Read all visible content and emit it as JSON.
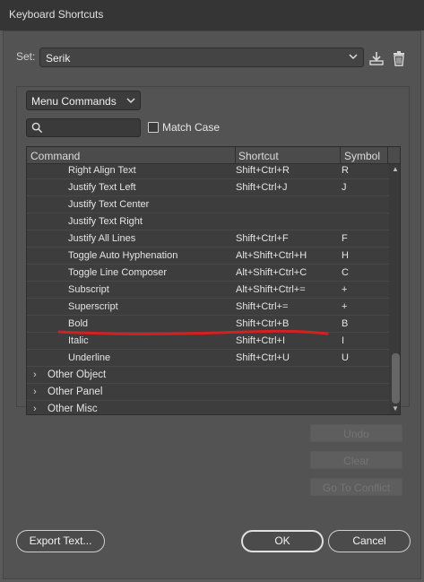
{
  "window": {
    "title": "Keyboard Shortcuts"
  },
  "set": {
    "label": "Set:",
    "value": "Serik"
  },
  "mode": {
    "value": "Menu Commands"
  },
  "search": {
    "placeholder": "",
    "value": ""
  },
  "match_case": {
    "label": "Match Case",
    "checked": false
  },
  "table": {
    "headers": {
      "command": "Command",
      "shortcut": "Shortcut",
      "symbol": "Symbol"
    },
    "rows": [
      {
        "command": "Right Align Text",
        "shortcut": "Shift+Ctrl+R",
        "symbol": "R"
      },
      {
        "command": "Justify Text Left",
        "shortcut": "Shift+Ctrl+J",
        "symbol": "J"
      },
      {
        "command": "Justify Text Center",
        "shortcut": "",
        "symbol": ""
      },
      {
        "command": "Justify Text Right",
        "shortcut": "",
        "symbol": ""
      },
      {
        "command": "Justify All Lines",
        "shortcut": "Shift+Ctrl+F",
        "symbol": "F"
      },
      {
        "command": "Toggle Auto Hyphenation",
        "shortcut": "Alt+Shift+Ctrl+H",
        "symbol": "H"
      },
      {
        "command": "Toggle Line Composer",
        "shortcut": "Alt+Shift+Ctrl+C",
        "symbol": "C"
      },
      {
        "command": "Subscript",
        "shortcut": "Alt+Shift+Ctrl+=",
        "symbol": "+"
      },
      {
        "command": "Superscript",
        "shortcut": "Shift+Ctrl+=",
        "symbol": "+"
      },
      {
        "command": "Bold",
        "shortcut": "Shift+Ctrl+B",
        "symbol": "B"
      },
      {
        "command": "Italic",
        "shortcut": "Shift+Ctrl+I",
        "symbol": "I"
      },
      {
        "command": "Underline",
        "shortcut": "Shift+Ctrl+U",
        "symbol": "U"
      }
    ],
    "groups": [
      {
        "label": "Other Object",
        "chevron": "›"
      },
      {
        "label": "Other Panel",
        "chevron": "›"
      },
      {
        "label": "Other Misc",
        "chevron": "›"
      }
    ]
  },
  "actions": {
    "undo": "Undo",
    "clear": "Clear",
    "go_to_conflict": "Go To Conflict"
  },
  "footer": {
    "export": "Export Text...",
    "ok": "OK",
    "cancel": "Cancel"
  },
  "icons": {
    "set_dropdown": "chevron-down-icon",
    "save_set": "download-icon",
    "delete_set": "trash-icon",
    "mode_dropdown": "chevron-down-icon",
    "search": "search-icon"
  },
  "colors": {
    "annotation_line": "#d42020",
    "background": "#535353",
    "titlebar": "#353535"
  }
}
